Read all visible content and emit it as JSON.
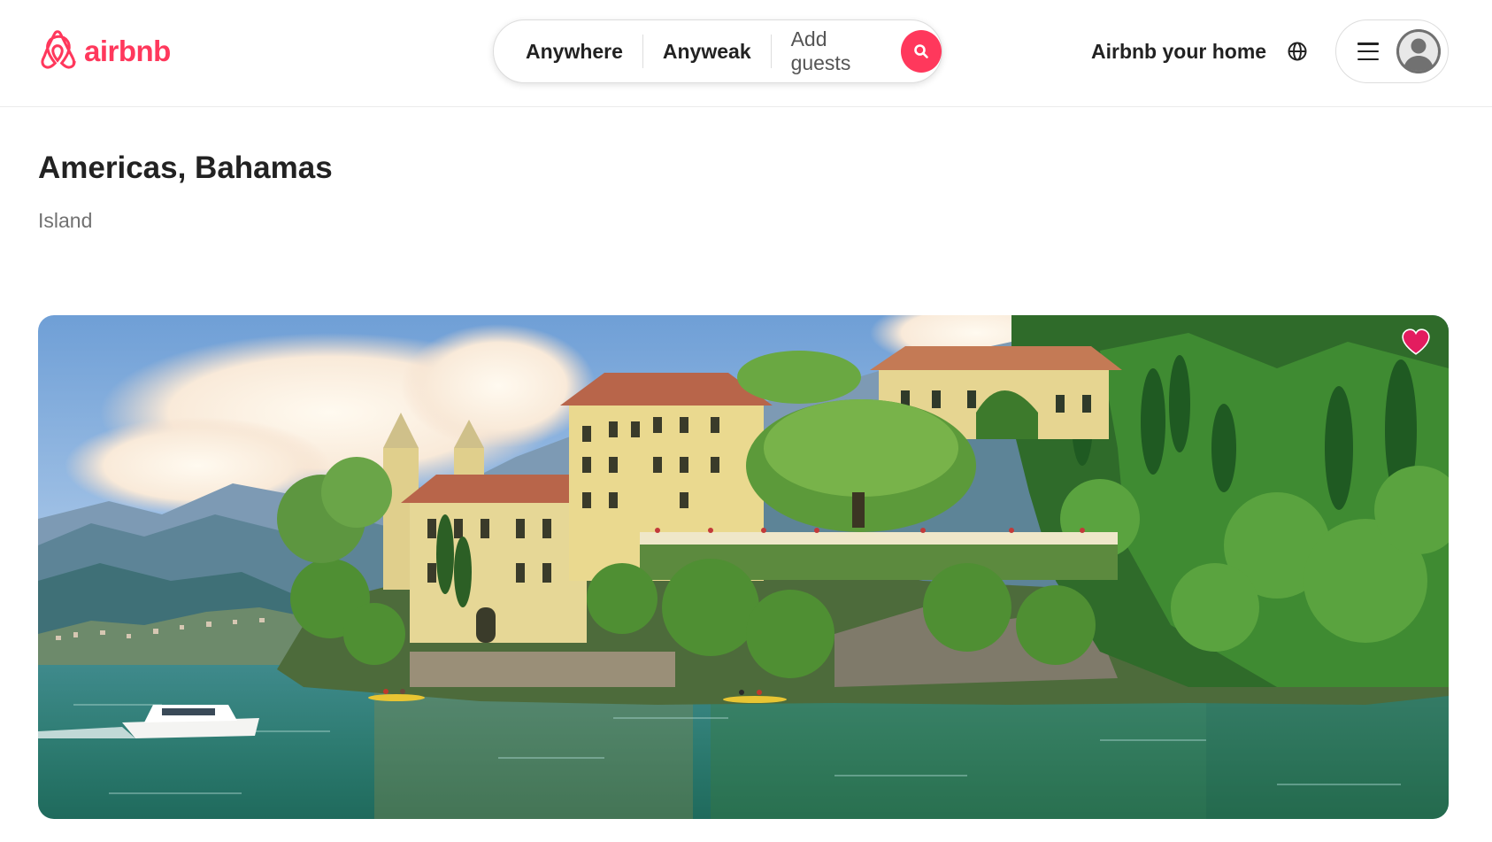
{
  "brand": {
    "name": "airbnb",
    "color": "#ff385c",
    "icon": "airbnb-logo-icon"
  },
  "search": {
    "location": "Anywhere",
    "dates": "Anyweak",
    "guests": "Add guests",
    "button_icon": "search-icon"
  },
  "header": {
    "host_link": "Airbnb your home",
    "language_icon": "globe-icon",
    "menu_icon": "hamburger-menu-icon",
    "avatar_icon": "user-avatar-icon"
  },
  "listing": {
    "title": "Americas, Bahamas",
    "category": "Island",
    "favorite_icon": "heart-icon",
    "favorite_color": "#e31c5f",
    "favorited": true
  }
}
